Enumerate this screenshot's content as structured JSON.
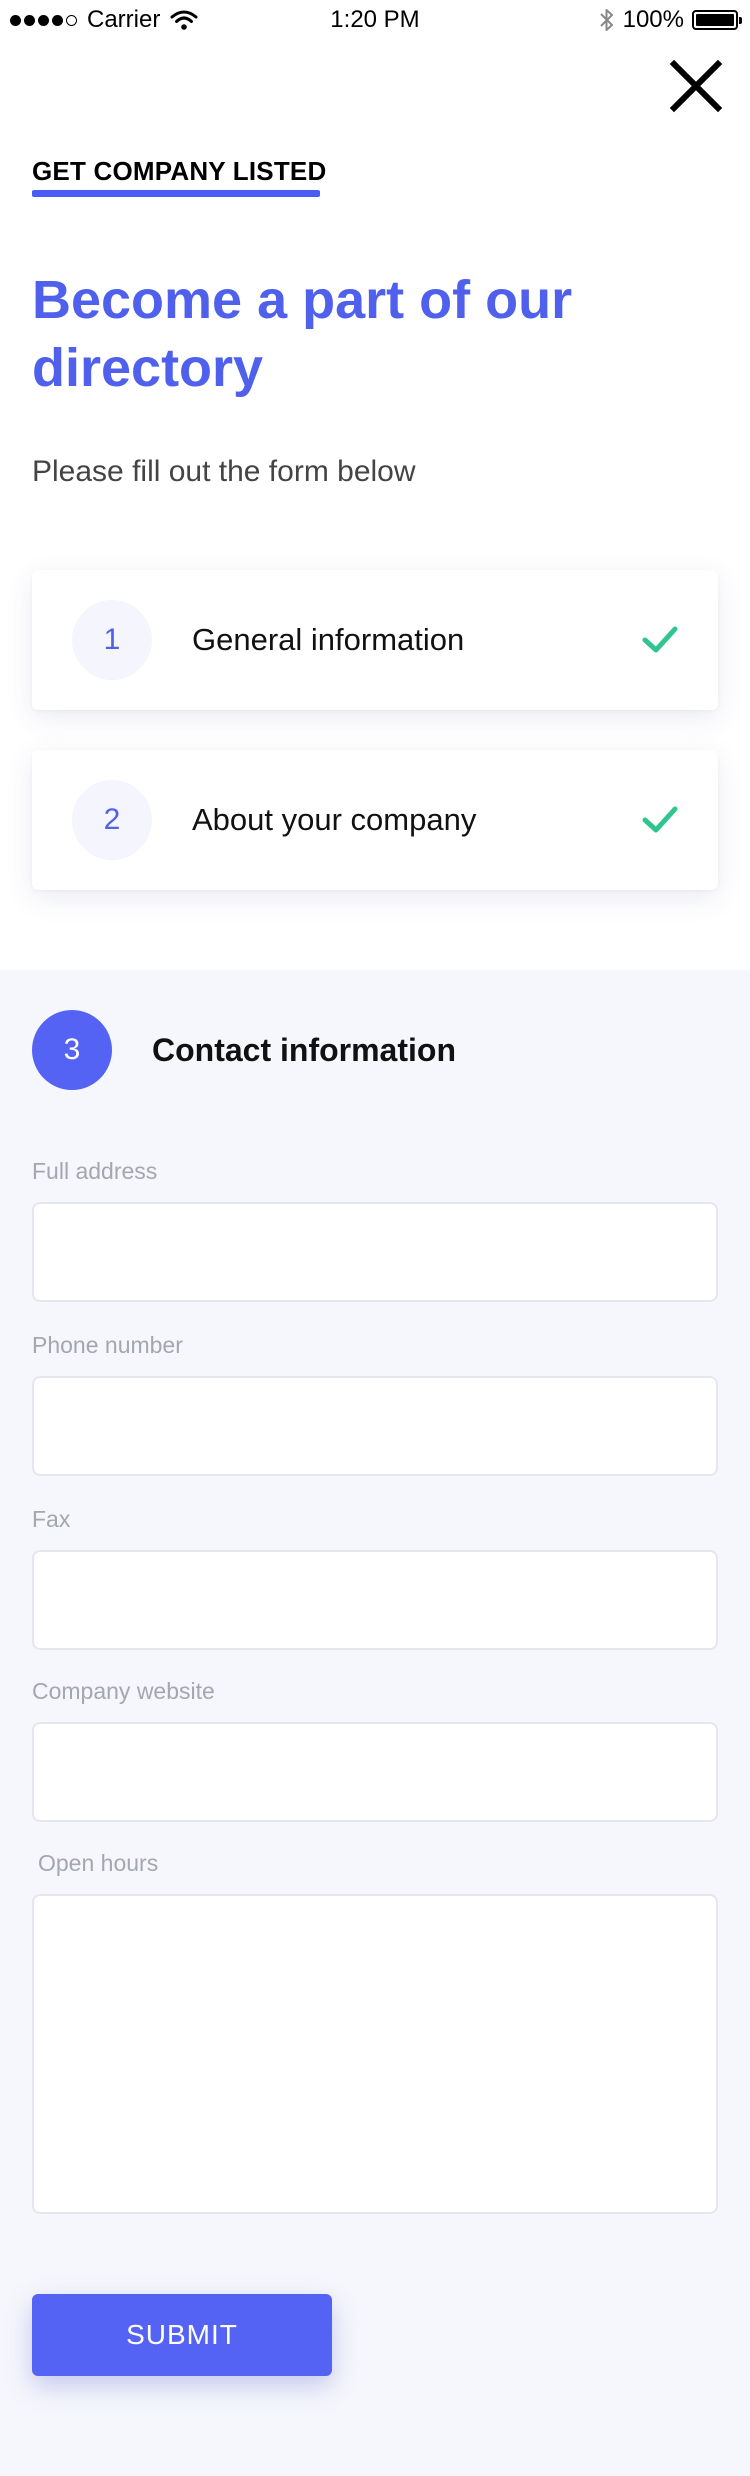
{
  "status_bar": {
    "carrier": "Carrier",
    "time": "1:20 PM",
    "battery": "100%",
    "battery_level": 1.0
  },
  "header": {
    "eyebrow": "GET COMPANY LISTED",
    "title": "Become a part of our directory",
    "subtitle": "Please fill out the form below"
  },
  "steps": [
    {
      "number": "1",
      "label": "General information",
      "completed": true
    },
    {
      "number": "2",
      "label": "About your company",
      "completed": true
    }
  ],
  "contact": {
    "number": "3",
    "title": "Contact information",
    "fields": {
      "full_address": {
        "label": "Full address",
        "value": ""
      },
      "phone": {
        "label": "Phone number",
        "value": ""
      },
      "fax": {
        "label": "Fax",
        "value": ""
      },
      "website": {
        "label": "Company website",
        "value": ""
      },
      "open_hours": {
        "label": "Open hours",
        "value": ""
      }
    },
    "submit_label": "SUBMIT"
  },
  "colors": {
    "accent": "#5563f5",
    "title": "#4f61ec",
    "check": "#2fc58f",
    "section_bg": "#f6f7fc"
  },
  "icons": [
    "signal-icon",
    "wifi-icon",
    "bluetooth-icon",
    "battery-icon",
    "close-icon",
    "check-icon"
  ]
}
